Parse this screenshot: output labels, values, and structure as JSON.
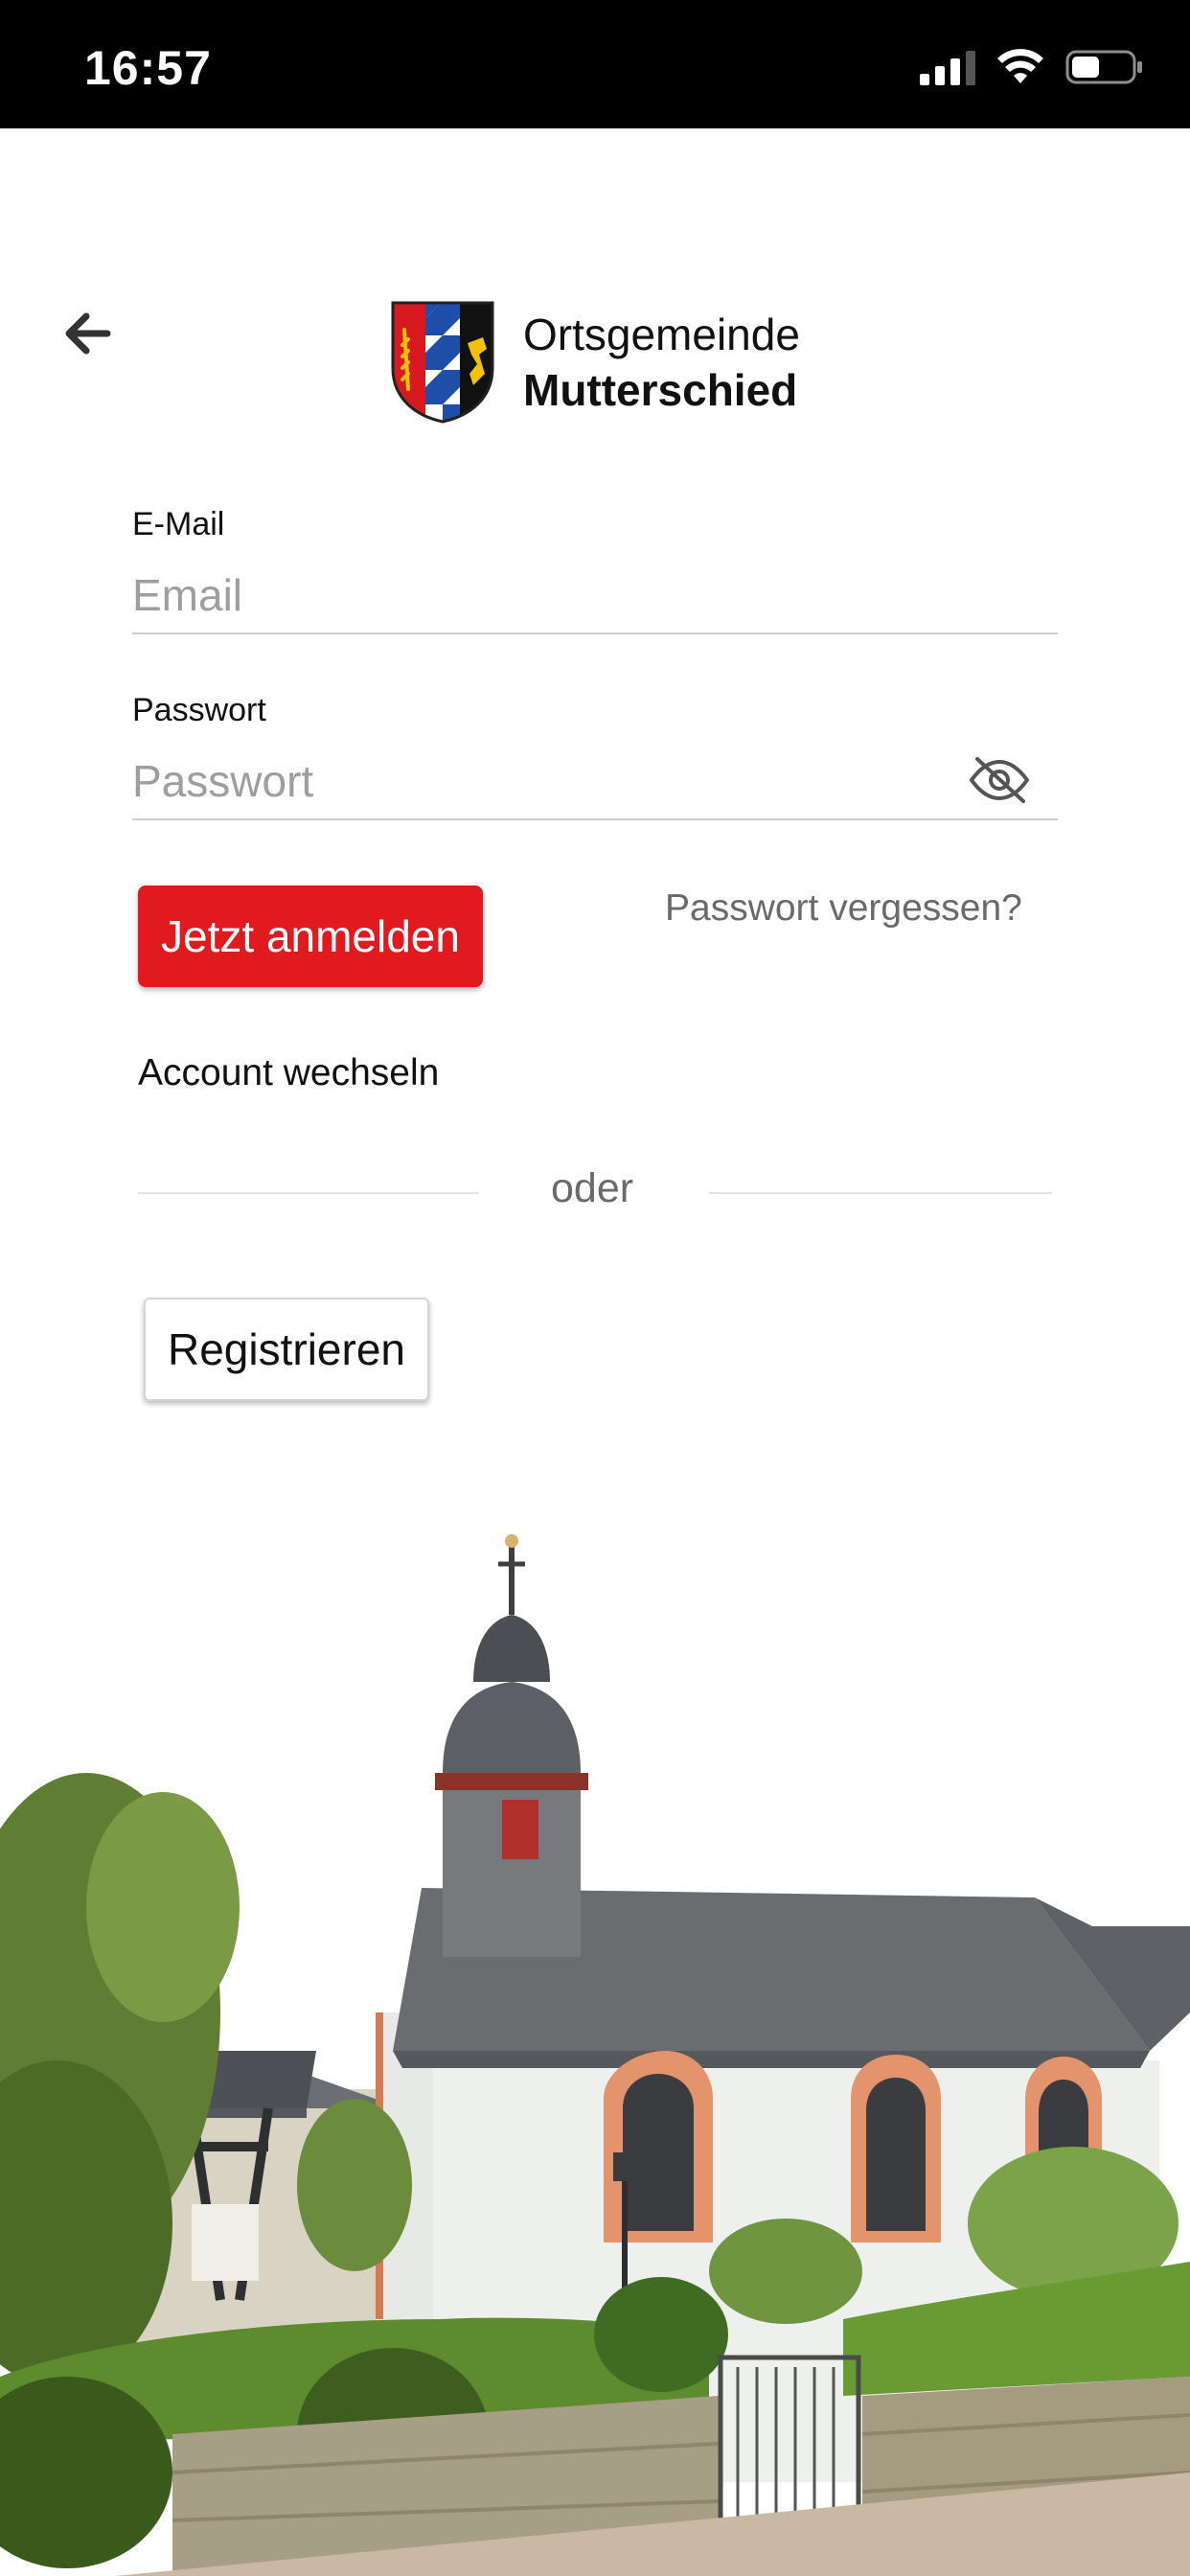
{
  "status_bar": {
    "time": "16:57",
    "icons": [
      "signal-icon",
      "wifi-icon",
      "battery-icon"
    ]
  },
  "header": {
    "back_icon": "arrow-left-icon",
    "logo_line1": "Ortsgemeinde",
    "logo_line2": "Mutterschied"
  },
  "form": {
    "email_label": "E-Mail",
    "email_placeholder": "Email",
    "email_value": "",
    "password_label": "Passwort",
    "password_placeholder": "Passwort",
    "password_value": "",
    "password_toggle_icon": "eye-slash-icon"
  },
  "actions": {
    "login_label": "Jetzt anmelden",
    "forgot_password": "Passwort vergessen?",
    "switch_account": "Account wechseln",
    "divider_text": "oder",
    "register_label": "Registrieren"
  },
  "colors": {
    "primary": "#e01a1f",
    "status_bar": "#000000",
    "muted_text": "#6a6a6a",
    "placeholder": "#9e9e9e"
  }
}
